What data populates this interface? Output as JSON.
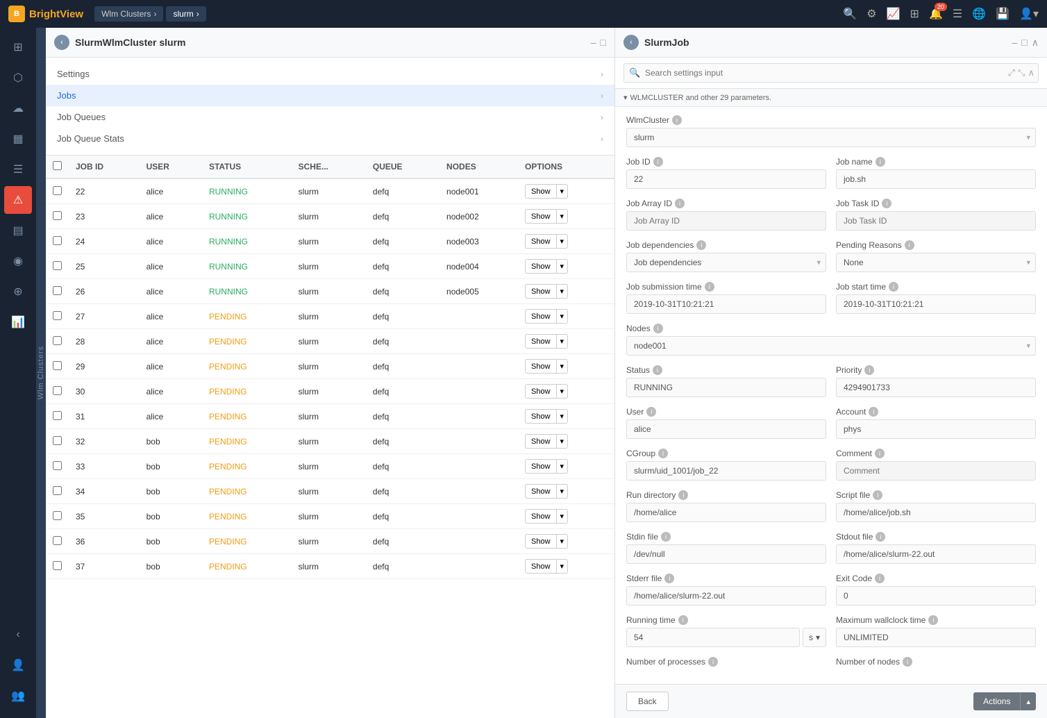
{
  "topNav": {
    "logoText1": "Bright",
    "logoText2": "View",
    "breadcrumbs": [
      {
        "id": "wlm-clusters",
        "label": "Wlm Clusters"
      },
      {
        "id": "slurm",
        "label": "slurm"
      }
    ]
  },
  "sidebar": {
    "icons": [
      {
        "id": "grid",
        "symbol": "⊞",
        "label": "dashboard"
      },
      {
        "id": "nodes",
        "symbol": "⬡",
        "label": "nodes"
      },
      {
        "id": "cloud",
        "symbol": "☁",
        "label": "cloud"
      },
      {
        "id": "layers",
        "symbol": "▦",
        "label": "layers"
      },
      {
        "id": "list",
        "symbol": "☰",
        "label": "list"
      },
      {
        "id": "alert",
        "symbol": "⚠",
        "label": "alert",
        "active": true
      },
      {
        "id": "table",
        "symbol": "▤",
        "label": "table"
      },
      {
        "id": "cloud2",
        "symbol": "◉",
        "label": "cloud2"
      },
      {
        "id": "group",
        "symbol": "⊕",
        "label": "group"
      },
      {
        "id": "report",
        "symbol": "📊",
        "label": "report"
      }
    ],
    "bottomIcons": [
      {
        "id": "arrow-left",
        "symbol": "‹",
        "label": "collapse"
      },
      {
        "id": "user",
        "symbol": "👤",
        "label": "user"
      },
      {
        "id": "users",
        "symbol": "👥",
        "label": "users"
      }
    ],
    "wlmLabel": "Wlm Clusters"
  },
  "leftPanel": {
    "title": "SlurmWlmCluster ",
    "titleBold": "slurm",
    "navItems": [
      {
        "id": "settings",
        "label": "Settings",
        "hasArrow": true,
        "active": false
      },
      {
        "id": "jobs",
        "label": "Jobs",
        "hasArrow": true,
        "active": true
      },
      {
        "id": "job-queues",
        "label": "Job Queues",
        "hasArrow": true,
        "active": false
      },
      {
        "id": "job-queue-stats",
        "label": "Job Queue Stats",
        "hasArrow": true,
        "active": false
      }
    ],
    "tableHeaders": [
      "JOB ID",
      "USER",
      "STATUS",
      "SCHE...",
      "QUEUE",
      "NODES",
      "OPTIONS"
    ],
    "tableRows": [
      {
        "id": "22",
        "user": "alice",
        "status": "RUNNING",
        "status_type": "running",
        "scheduler": "slurm",
        "queue": "defq",
        "nodes": "node001"
      },
      {
        "id": "23",
        "user": "alice",
        "status": "RUNNING",
        "status_type": "running",
        "scheduler": "slurm",
        "queue": "defq",
        "nodes": "node002"
      },
      {
        "id": "24",
        "user": "alice",
        "status": "RUNNING",
        "status_type": "running",
        "scheduler": "slurm",
        "queue": "defq",
        "nodes": "node003"
      },
      {
        "id": "25",
        "user": "alice",
        "status": "RUNNING",
        "status_type": "running",
        "scheduler": "slurm",
        "queue": "defq",
        "nodes": "node004"
      },
      {
        "id": "26",
        "user": "alice",
        "status": "RUNNING",
        "status_type": "running",
        "scheduler": "slurm",
        "queue": "defq",
        "nodes": "node005"
      },
      {
        "id": "27",
        "user": "alice",
        "status": "PENDING",
        "status_type": "pending",
        "scheduler": "slurm",
        "queue": "defq",
        "nodes": ""
      },
      {
        "id": "28",
        "user": "alice",
        "status": "PENDING",
        "status_type": "pending",
        "scheduler": "slurm",
        "queue": "defq",
        "nodes": ""
      },
      {
        "id": "29",
        "user": "alice",
        "status": "PENDING",
        "status_type": "pending",
        "scheduler": "slurm",
        "queue": "defq",
        "nodes": ""
      },
      {
        "id": "30",
        "user": "alice",
        "status": "PENDING",
        "status_type": "pending",
        "scheduler": "slurm",
        "queue": "defq",
        "nodes": ""
      },
      {
        "id": "31",
        "user": "alice",
        "status": "PENDING",
        "status_type": "pending",
        "scheduler": "slurm",
        "queue": "defq",
        "nodes": ""
      },
      {
        "id": "32",
        "user": "bob",
        "status": "PENDING",
        "status_type": "pending",
        "scheduler": "slurm",
        "queue": "defq",
        "nodes": ""
      },
      {
        "id": "33",
        "user": "bob",
        "status": "PENDING",
        "status_type": "pending",
        "scheduler": "slurm",
        "queue": "defq",
        "nodes": ""
      },
      {
        "id": "34",
        "user": "bob",
        "status": "PENDING",
        "status_type": "pending",
        "scheduler": "slurm",
        "queue": "defq",
        "nodes": ""
      },
      {
        "id": "35",
        "user": "bob",
        "status": "PENDING",
        "status_type": "pending",
        "scheduler": "slurm",
        "queue": "defq",
        "nodes": ""
      },
      {
        "id": "36",
        "user": "bob",
        "status": "PENDING",
        "status_type": "pending",
        "scheduler": "slurm",
        "queue": "defq",
        "nodes": ""
      },
      {
        "id": "37",
        "user": "bob",
        "status": "PENDING",
        "status_type": "pending",
        "scheduler": "slurm",
        "queue": "defq",
        "nodes": ""
      }
    ]
  },
  "rightPanel": {
    "title": "SlurmJob",
    "searchPlaceholder": "Search settings input",
    "paramsBanner": "WLMCLUSTER and other 29 parameters.",
    "fields": {
      "wlmCluster": {
        "label": "WlmCluster",
        "value": "slurm"
      },
      "jobId": {
        "label": "Job ID",
        "value": "22"
      },
      "jobName": {
        "label": "Job name",
        "value": "job.sh"
      },
      "jobArrayId": {
        "label": "Job Array ID",
        "value": "",
        "placeholder": "Job Array ID"
      },
      "jobTaskId": {
        "label": "Job Task ID",
        "value": "",
        "placeholder": "Job Task ID"
      },
      "jobDependencies": {
        "label": "Job dependencies",
        "value": "",
        "placeholder": "Job dependencies"
      },
      "pendingReasons": {
        "label": "Pending Reasons",
        "value": "None"
      },
      "jobSubmissionTime": {
        "label": "Job submission time",
        "value": "2019-10-31T10:21:21"
      },
      "jobStartTime": {
        "label": "Job start time",
        "value": "2019-10-31T10:21:21"
      },
      "nodes": {
        "label": "Nodes",
        "value": "node001"
      },
      "status": {
        "label": "Status",
        "value": "RUNNING"
      },
      "priority": {
        "label": "Priority",
        "value": "4294901733"
      },
      "user": {
        "label": "User",
        "value": "alice"
      },
      "account": {
        "label": "Account",
        "value": "phys"
      },
      "cgroup": {
        "label": "CGroup",
        "value": "slurm/uid_1001/job_22"
      },
      "comment": {
        "label": "Comment",
        "value": "",
        "placeholder": "Comment"
      },
      "runDirectory": {
        "label": "Run directory",
        "value": "/home/alice"
      },
      "scriptFile": {
        "label": "Script file",
        "value": "/home/alice/job.sh"
      },
      "stdinFile": {
        "label": "Stdin file",
        "value": "/dev/null"
      },
      "stdoutFile": {
        "label": "Stdout file",
        "value": "/home/alice/slurm-22.out"
      },
      "stderrFile": {
        "label": "Stderr file",
        "value": "/home/alice/slurm-22.out"
      },
      "exitCode": {
        "label": "Exit Code",
        "value": "0"
      },
      "runningTime": {
        "label": "Running time",
        "value": "54",
        "unit": "s"
      },
      "maxWallclockTime": {
        "label": "Maximum wallclock time",
        "value": "UNLIMITED"
      },
      "numberOfProcesses": {
        "label": "Number of processes",
        "value": ""
      },
      "numberOfNodes": {
        "label": "Number of nodes",
        "value": ""
      }
    },
    "bottomBar": {
      "backLabel": "Back",
      "actionsLabel": "Actions"
    }
  },
  "icons": {
    "search": "🔍",
    "gear": "⚙",
    "chart": "📈",
    "table": "⊞",
    "bell": "🔔",
    "list": "☰",
    "globe": "🌐",
    "save": "💾",
    "user": "👤",
    "chevronRight": "›",
    "chevronDown": "▾",
    "chevronUp": "▴",
    "collapse": "–",
    "expand": "□",
    "close": "×",
    "back": "‹",
    "info": "i",
    "notifCount": "20"
  }
}
